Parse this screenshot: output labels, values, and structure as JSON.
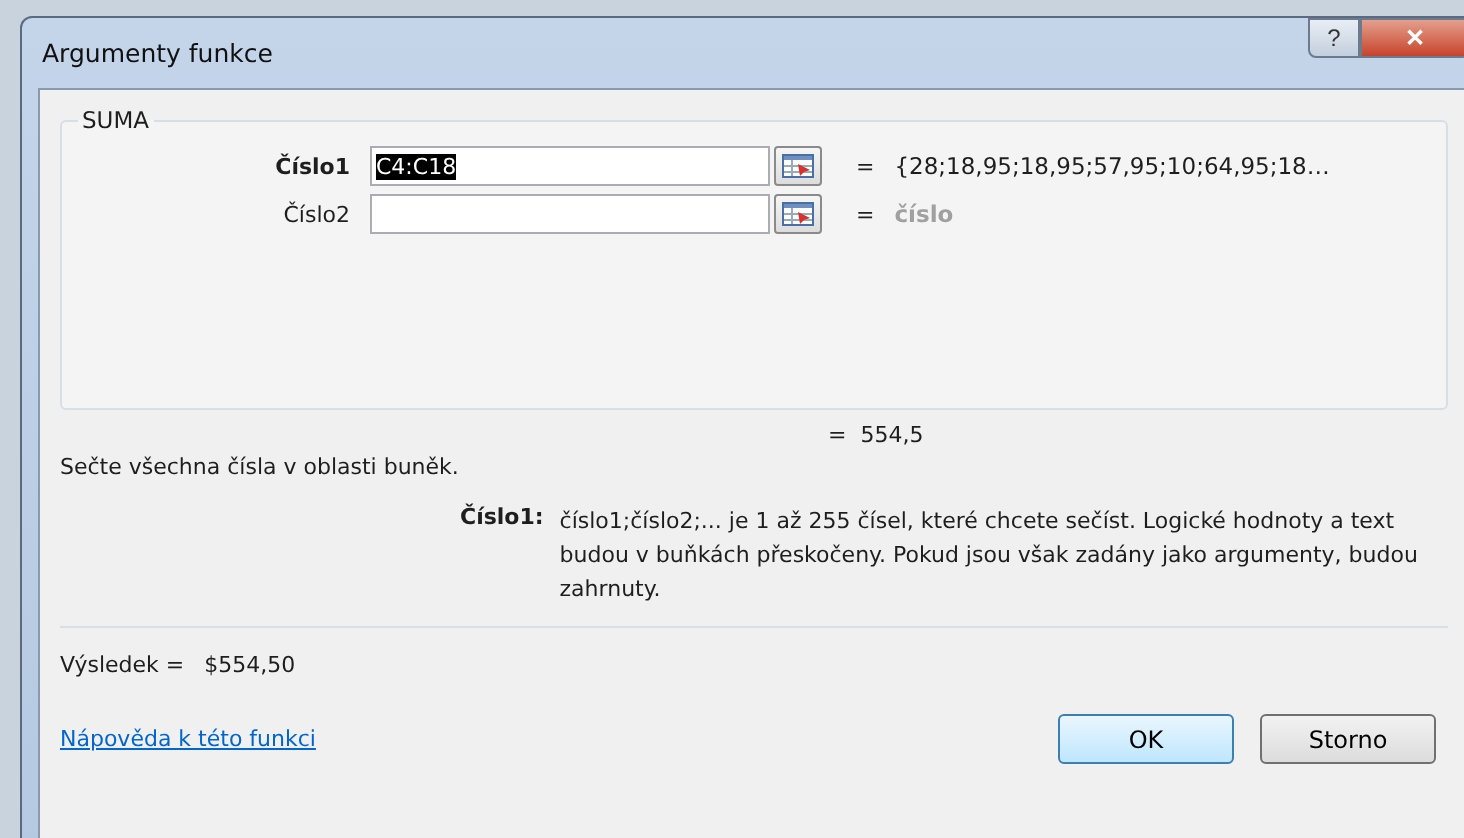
{
  "window": {
    "title": "Argumenty funkce",
    "buttons": [
      "?",
      "✕"
    ]
  },
  "function_group": {
    "name": "SUMA",
    "arguments": [
      {
        "label": "Číslo1",
        "value": "C4:C18",
        "equals": "=",
        "result": "{28;18,95;18,95;57,95;10;64,95;18…",
        "required": true
      },
      {
        "label": "Číslo2",
        "equals": "=",
        "result": "číslo",
        "required": false
      }
    ]
  },
  "formula_result": "=  554,5",
  "description": "Sečte všechna čísla v oblasti buněk.",
  "argument_help": {
    "label": "Číslo1:",
    "text": "číslo1;číslo2;... je 1 až 255 čísel, které chcete sečíst. Logické hodnoty a text budou v buňkách přeskočeny. Pokud jsou však zadány jako argumenty, budou zahrnuty."
  },
  "result": {
    "label": "Výsledek =",
    "value": "$554,50"
  },
  "help_link": "Nápověda k této funkci",
  "buttons": [
    {
      "label": "OK",
      "selected": true
    },
    {
      "label": "Storno",
      "selected": false
    }
  ]
}
